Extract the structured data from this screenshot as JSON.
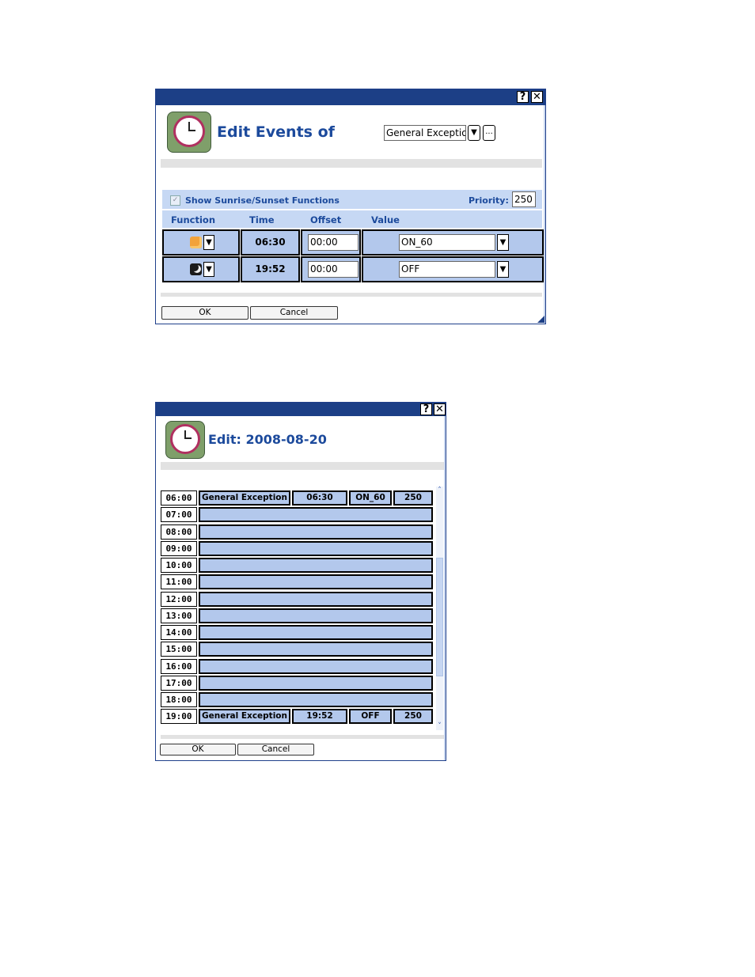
{
  "dialog1": {
    "help_label": "?",
    "close_label": "✕",
    "title": "Edit Events of",
    "group_select": "General Exception",
    "group_dropdown": "▼",
    "browse_label": "...",
    "show_sunrise_checkbox": "✓",
    "show_sunrise_label": "Show Sunrise/Sunset Functions",
    "priority_label": "Priority:",
    "priority_value": "250",
    "columns": [
      "Function",
      "Time",
      "Offset",
      "Value"
    ],
    "rows": [
      {
        "function_icon": "sunrise-icon",
        "time": "06:30",
        "offset": "00:00",
        "value": "ON_60"
      },
      {
        "function_icon": "sunset-icon",
        "time": "19:52",
        "offset": "00:00",
        "value": "OFF"
      }
    ],
    "dropdown_arrow": "▼",
    "ok_label": "OK",
    "cancel_label": "Cancel"
  },
  "dialog2": {
    "help_label": "?",
    "close_label": "✕",
    "title": "Edit: 2008-08-20",
    "hours": [
      "06:00",
      "07:00",
      "08:00",
      "09:00",
      "10:00",
      "11:00",
      "12:00",
      "13:00",
      "14:00",
      "15:00",
      "16:00",
      "17:00",
      "18:00",
      "19:00"
    ],
    "events": [
      {
        "hour": "06:00",
        "name": "General Exception",
        "time": "06:30",
        "value": "ON_60",
        "priority": "250"
      },
      {
        "hour": "19:00",
        "name": "General Exception",
        "time": "19:52",
        "value": "OFF",
        "priority": "250"
      }
    ],
    "scroll_up": "˄",
    "scroll_down": "˅",
    "ok_label": "OK",
    "cancel_label": "Cancel"
  },
  "colors": {
    "titlebar": "#1c3f86",
    "cell_blue": "#b3c8ec",
    "header_blue": "#c6d8f4",
    "title_text": "#1c4a9c"
  }
}
